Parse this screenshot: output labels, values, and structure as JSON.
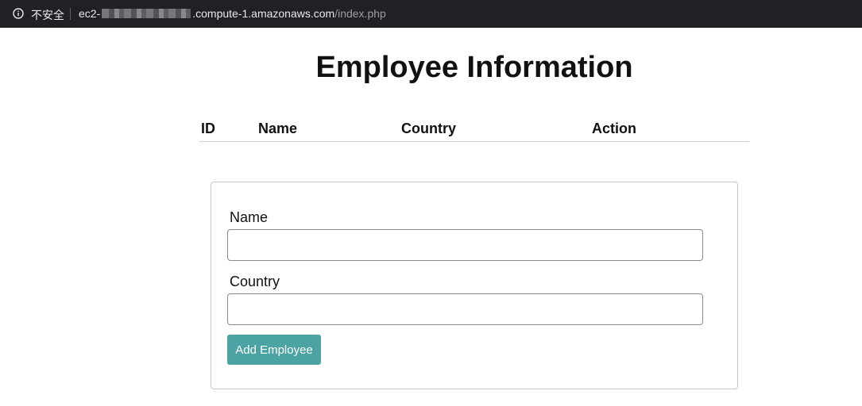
{
  "browser": {
    "security_label": "不安全",
    "url_host_start": "ec2-",
    "url_host_end": ".compute-1.amazonaws.com",
    "url_path": "/index.php"
  },
  "page": {
    "title": "Employee Information"
  },
  "table": {
    "columns": [
      "ID",
      "Name",
      "Country",
      "Action"
    ],
    "rows": []
  },
  "form": {
    "name_label": "Name",
    "name_value": "",
    "country_label": "Country",
    "country_value": "",
    "submit_label": "Add Employee",
    "button_color": "#4ba3a3"
  }
}
